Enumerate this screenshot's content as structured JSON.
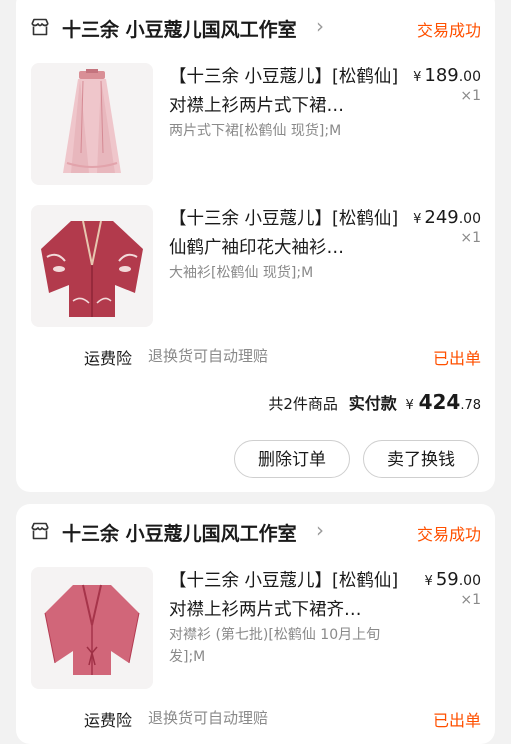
{
  "orders": [
    {
      "shop": "十三余 小豆蔻儿国风工作室",
      "status": "交易成功",
      "items": [
        {
          "title": "【十三余 小豆蔻儿】[松鹤仙]对襟上衫两片式下裙…",
          "sku": "两片式下裙[松鹤仙 现货];M",
          "currency": "¥",
          "price_int": "189",
          "price_dec": ".00",
          "qty": "×1",
          "image": "pink-two-piece-skirt"
        },
        {
          "title": "【十三余 小豆蔻儿】[松鹤仙]仙鹤广袖印花大袖衫…",
          "sku": "大袖衫[松鹤仙 现货];M",
          "currency": "¥",
          "price_int": "249",
          "price_dec": ".00",
          "qty": "×1",
          "image": "red-crane-print-wide-sleeve-robe"
        }
      ],
      "service": {
        "label": "运费险",
        "desc": "退换货可自动理赔",
        "status": "已出单"
      },
      "summary": {
        "count_text": "共2件商品",
        "paid_label": "实付款",
        "currency": "¥",
        "amount_int": "424",
        "amount_dec": ".78"
      },
      "actions": {
        "delete": "删除订单",
        "resell": "卖了换钱"
      }
    },
    {
      "shop": "十三余 小豆蔻儿国风工作室",
      "status": "交易成功",
      "items": [
        {
          "title": "【十三余 小豆蔻儿】[松鹤仙]对襟上衫两片式下裙齐…",
          "sku": "对襟衫 (第七批)[松鹤仙 10月上旬发];M",
          "currency": "¥",
          "price_int": "59",
          "price_dec": ".00",
          "qty": "×1",
          "image": "red-sheer-jacket"
        }
      ],
      "service": {
        "label": "运费险",
        "desc": "退换货可自动理赔",
        "status": "已出单"
      }
    }
  ],
  "colors": {
    "accent": "#ff5000",
    "muted": "#8a8a8a",
    "background": "#f2f2f2"
  }
}
